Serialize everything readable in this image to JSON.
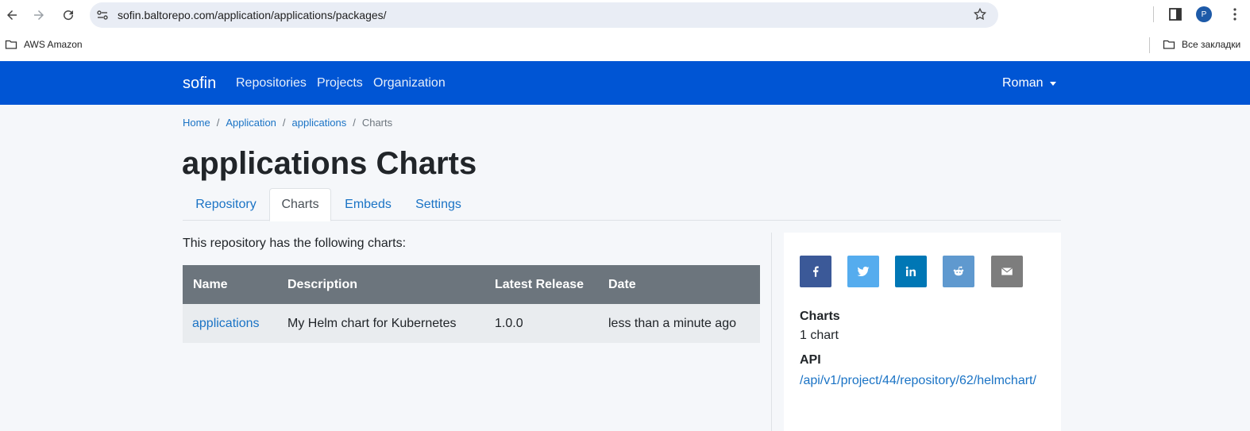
{
  "browser": {
    "url": "sofin.baltorepo.com/application/applications/packages/",
    "profile_initial": "P",
    "bookmarks": [
      {
        "label": "AWS Amazon"
      },
      {
        "label": "Все закладки"
      }
    ]
  },
  "navbar": {
    "brand": "sofin",
    "links": [
      "Repositories",
      "Projects",
      "Organization"
    ],
    "user": "Roman",
    "color": "#0055d4"
  },
  "breadcrumb": [
    "Home",
    "Application",
    "applications",
    "Charts"
  ],
  "page": {
    "title": "applications Charts",
    "tabs": [
      "Repository",
      "Charts",
      "Embeds",
      "Settings"
    ],
    "active_tab": "Charts",
    "intro": "This repository has the following charts:"
  },
  "table": {
    "headers": [
      "Name",
      "Description",
      "Latest Release",
      "Date"
    ],
    "rows": [
      {
        "name": "applications",
        "description": "My Helm chart for Kubernetes",
        "release": "1.0.0",
        "date": "less than a minute ago"
      }
    ]
  },
  "sidebar": {
    "share": [
      {
        "icon": "facebook-icon",
        "color": "#3b5998"
      },
      {
        "icon": "twitter-icon",
        "color": "#55acee"
      },
      {
        "icon": "linkedin-icon",
        "color": "#0077b5"
      },
      {
        "icon": "reddit-icon",
        "color": "#5f99cf"
      },
      {
        "icon": "email-icon",
        "color": "#7d7d7d"
      }
    ],
    "charts_label": "Charts",
    "charts_value": "1 chart",
    "api_label": "API",
    "api_value": "/api/v1/project/44/repository/62/helmchart/"
  }
}
